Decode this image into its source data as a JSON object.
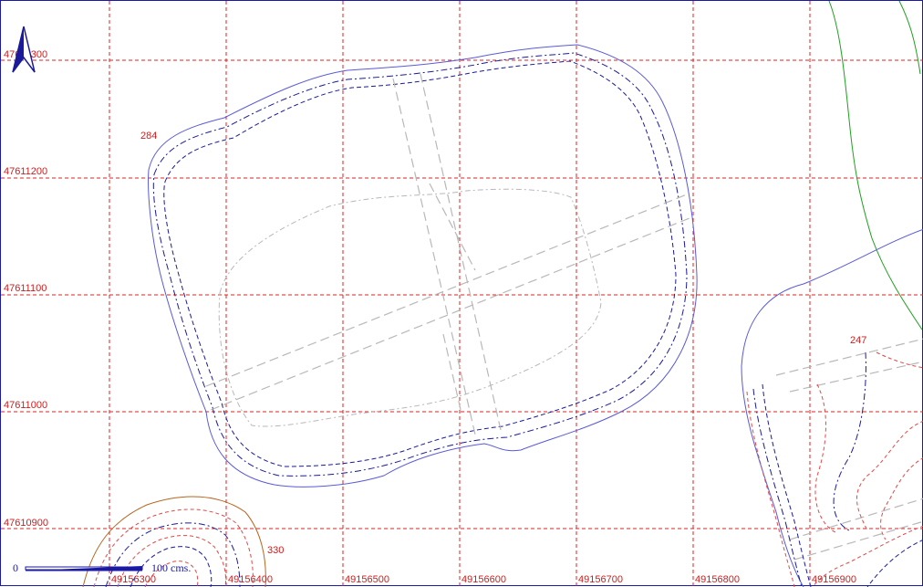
{
  "map": {
    "grid_x_labels": [
      "49156300",
      "49156400",
      "49156500",
      "49156600",
      "49156700",
      "49156800",
      "49156900"
    ],
    "grid_y_labels": [
      "47611300",
      "47611200",
      "47611100",
      "47611000",
      "47610900"
    ],
    "contour_labels": [
      "284",
      "247",
      "330"
    ],
    "scale_bar": {
      "start_label": "0",
      "end_label": "100 cms."
    },
    "north_arrow_icon": "north-arrow-icon",
    "colors": {
      "grid": "#e02020",
      "outer_boundary": "#5a5ad8",
      "contour_blue": "#1a1a9a",
      "road": "#b8b8b8",
      "stream": "#1fa01f",
      "contour_red": "#e04848",
      "contour_brown": "#b8651e"
    }
  }
}
